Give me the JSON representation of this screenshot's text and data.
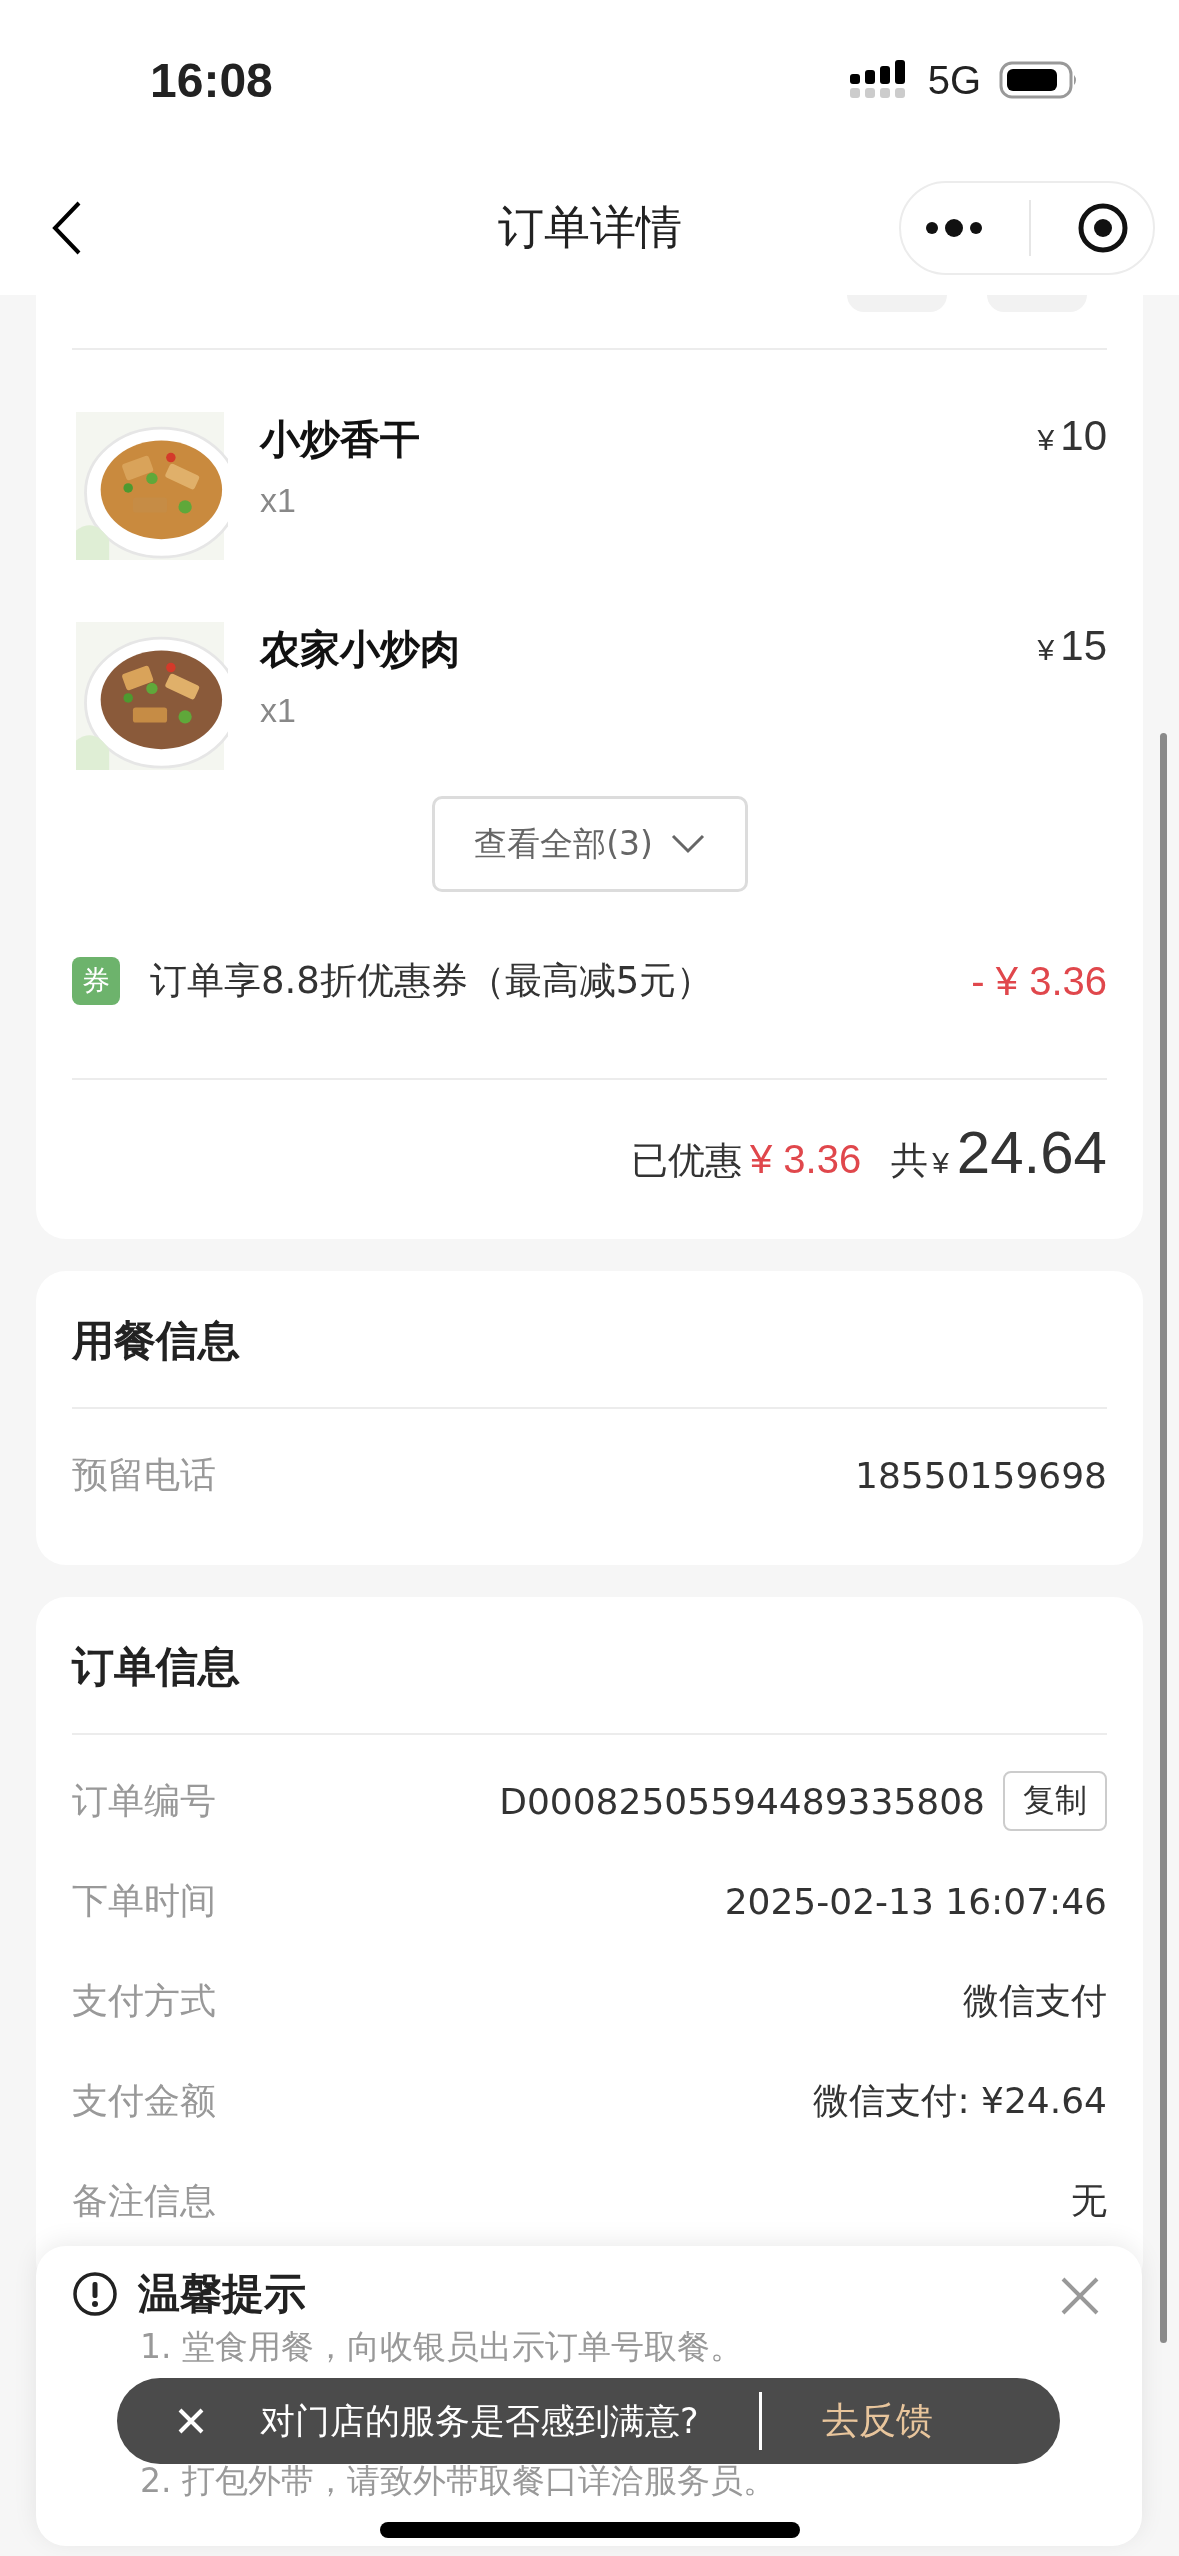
{
  "status_bar": {
    "time": "16:08",
    "network": "5G"
  },
  "nav": {
    "title": "订单详情"
  },
  "items": [
    {
      "name": "小炒香干",
      "qty": "x1",
      "currency": "¥",
      "price": "10",
      "kind": "picture"
    },
    {
      "name": "农家小炒肉",
      "qty": "x1",
      "currency": "¥",
      "price": "15",
      "kind": "picture"
    }
  ],
  "view_all": {
    "label": "查看全部(3)",
    "expanded": false
  },
  "coupon": {
    "badge": "券",
    "text": "订单享8.8折优惠券（最高减5元）",
    "amount": "- ¥ 3.36"
  },
  "summary": {
    "discount_label": "已优惠",
    "discount": "¥ 3.36",
    "total_label": "共",
    "currency": "¥",
    "total": "24.64"
  },
  "dining_info": {
    "title": "用餐信息",
    "rows": [
      {
        "label": "预留电话",
        "value": "18550159698"
      }
    ]
  },
  "order_info": {
    "title": "订单信息",
    "rows": [
      {
        "label": "订单编号",
        "value": "D00082505594489335808",
        "action": "复制"
      },
      {
        "label": "下单时间",
        "value": "2025-02-13 16:07:46"
      },
      {
        "label": "支付方式",
        "value": "微信支付"
      },
      {
        "label": "支付金额",
        "value": "微信支付: ¥24.64"
      },
      {
        "label": "备注信息",
        "value": "无"
      }
    ]
  },
  "tips": {
    "title": "温馨提示",
    "lines": [
      "1. 堂食用餐，向收银员出示订单号取餐。",
      "2. 打包外带，请致外带取餐口详洽服务员。"
    ]
  },
  "toast": {
    "text": "对门店的服务是否感到满意?",
    "action": "去反馈"
  }
}
